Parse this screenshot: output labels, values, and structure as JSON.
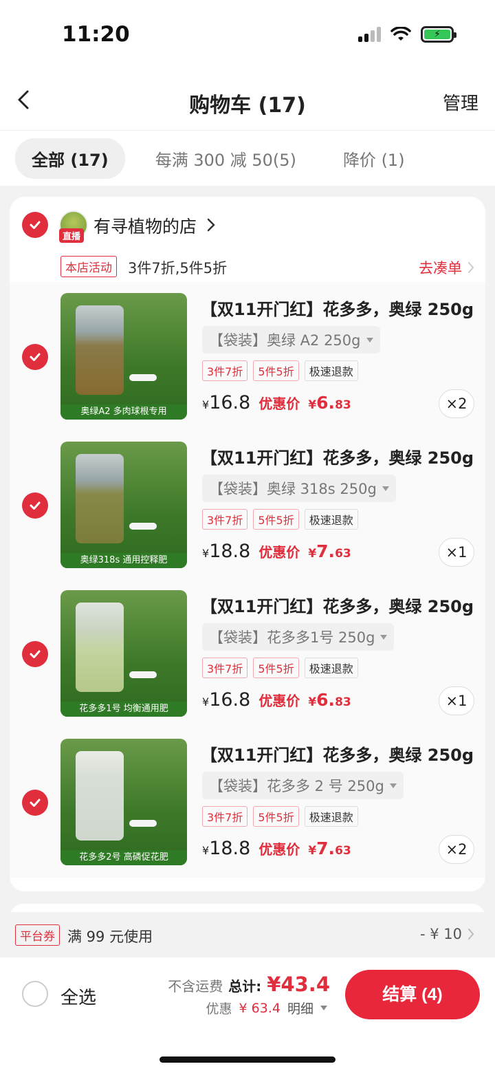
{
  "status_bar": {
    "time": "11:20"
  },
  "nav": {
    "title": "购物车 (17)",
    "manage": "管理"
  },
  "tabs": [
    {
      "label": "全部 (17)"
    },
    {
      "label": "每满 300 减 50(5)"
    },
    {
      "label": "降价 (1)"
    }
  ],
  "store": {
    "name": "有寻植物的店",
    "live_badge": "直播",
    "promo_tag": "本店活动",
    "promo_text": "3件7折,5件5折",
    "promo_link": "去凑单"
  },
  "items": [
    {
      "title": "【双11开门红】花多多，奥绿 250g",
      "sku": "【袋装】奥绿 A2 250g",
      "tags": [
        "3件7折",
        "5件5折",
        "极速退款"
      ],
      "price": "16.8",
      "deal_label": "优惠价",
      "deal_int": "6.",
      "deal_dec": "83",
      "qty": "×2",
      "thumb_label": "奥绿A2 多肉球根专用"
    },
    {
      "title": "【双11开门红】花多多，奥绿 250g",
      "sku": "【袋装】奥绿 318s 250g",
      "tags": [
        "3件7折",
        "5件5折",
        "极速退款"
      ],
      "price": "18.8",
      "deal_label": "优惠价",
      "deal_int": "7.",
      "deal_dec": "63",
      "qty": "×1",
      "thumb_label": "奥绿318s 通用控释肥"
    },
    {
      "title": "【双11开门红】花多多，奥绿 250g",
      "sku": "【袋装】花多多1号 250g",
      "tags": [
        "3件7折",
        "5件5折",
        "极速退款"
      ],
      "price": "16.8",
      "deal_label": "优惠价",
      "deal_int": "6.",
      "deal_dec": "83",
      "qty": "×1",
      "thumb_label": "花多多1号 均衡通用肥"
    },
    {
      "title": "【双11开门红】花多多，奥绿 250g",
      "sku": "【袋装】花多多 2 号 250g",
      "tags": [
        "3件7折",
        "5件5折",
        "极速退款"
      ],
      "price": "18.8",
      "deal_label": "优惠价",
      "deal_int": "7.",
      "deal_dec": "63",
      "qty": "×2",
      "thumb_label": "花多多2号 高磷促花肥"
    }
  ],
  "currency": "¥",
  "coupon": {
    "tag": "平台券",
    "text": "满 99 元使用",
    "value": "- ¥ 10"
  },
  "bottom": {
    "select_all": "全选",
    "shipping_note": "不含运费",
    "total_label": "总计:",
    "total_value": "¥43.4",
    "discount_label": "优惠",
    "discount_value": "¥ 63.4",
    "detail_label": "明细",
    "checkout": "结算 (4)"
  },
  "colors": {
    "accent": "#e02e3c",
    "button": "#e8283a"
  }
}
